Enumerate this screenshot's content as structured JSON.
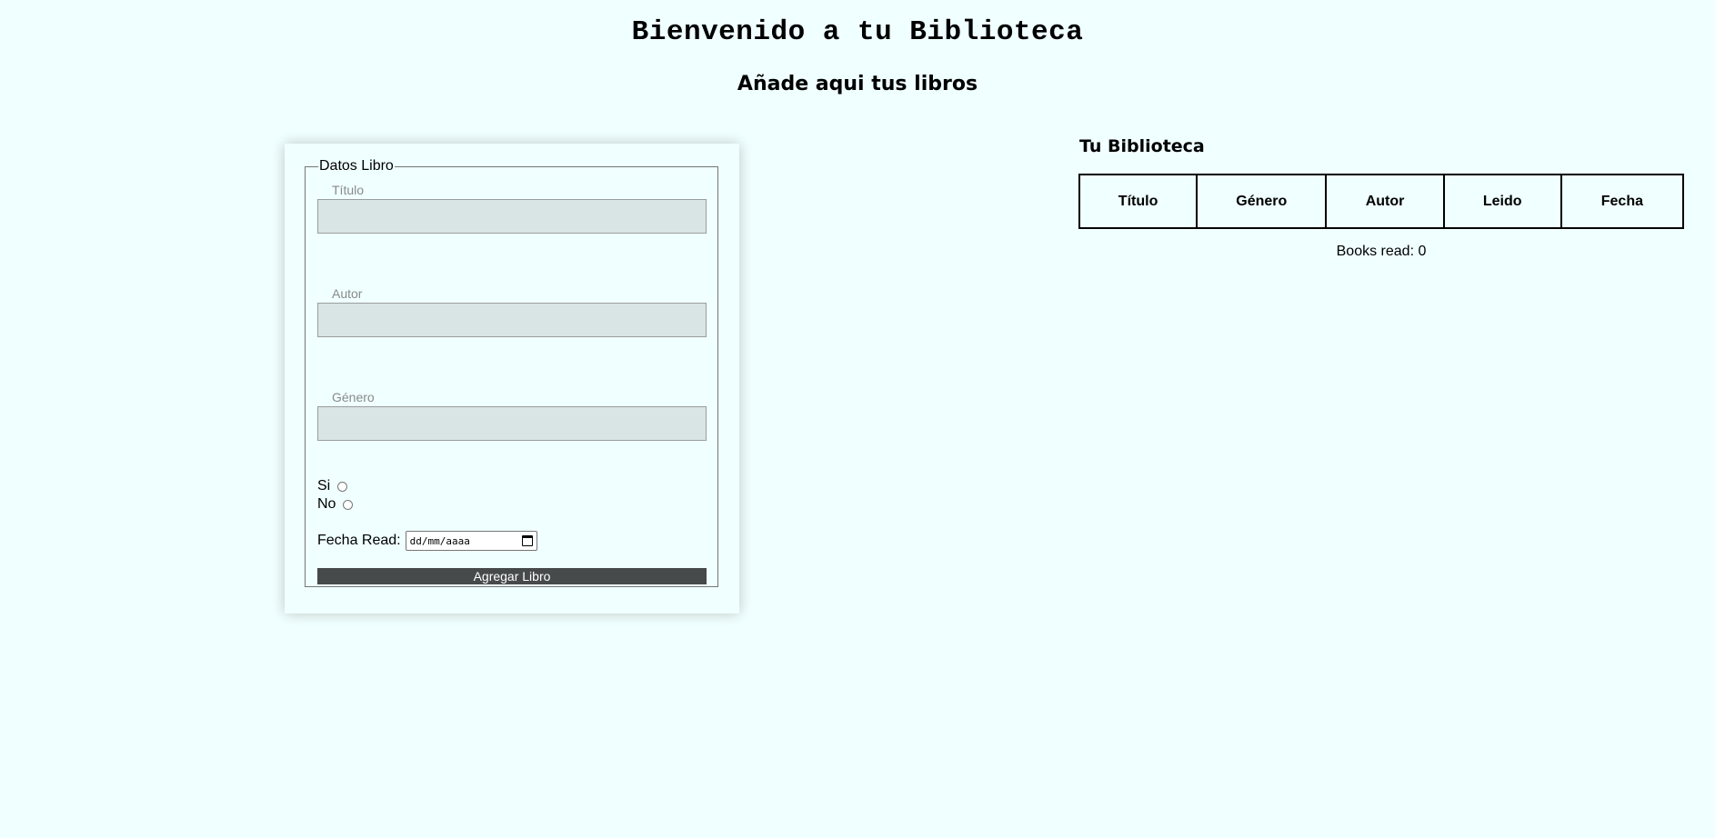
{
  "header": {
    "title": "Bienvenido a tu Biblioteca",
    "subtitle": "Añade aqui tus libros"
  },
  "form": {
    "legend": "Datos Libro",
    "fields": [
      {
        "label": "Título",
        "value": ""
      },
      {
        "label": "Autor",
        "value": ""
      },
      {
        "label": "Género",
        "value": ""
      }
    ],
    "read_options": [
      {
        "label": "Si",
        "checked": false
      },
      {
        "label": "No",
        "checked": false
      }
    ],
    "date_label": "Fecha Read:",
    "date_placeholder": "dd/mm/aaaa",
    "date_icon": "calendar-icon",
    "submit_label": "Agregar Libro"
  },
  "library": {
    "title": "Tu Biblioteca",
    "columns": [
      "Título",
      "Género",
      "Autor",
      "Leido",
      "Fecha"
    ],
    "rows": [],
    "books_read": "Books read: 0"
  },
  "colors": {
    "background": "#f0ffff",
    "input_background": "#d9e4e4",
    "button_background": "#464a4a"
  }
}
